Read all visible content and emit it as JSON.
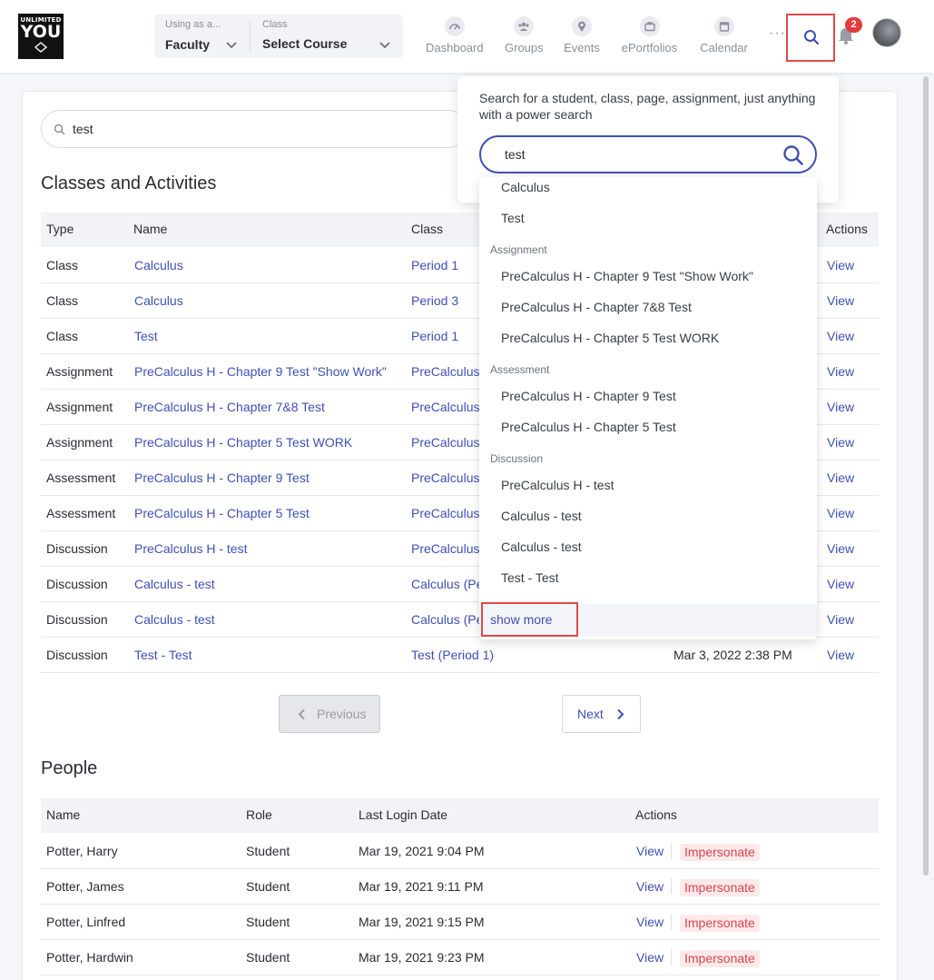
{
  "header": {
    "logo_text_top": "UNLIMITED",
    "logo_text_main": "YOU",
    "using_as_label": "Using as a...",
    "using_as_value": "Faculty",
    "class_label": "Class",
    "class_value": "Select Course",
    "nav": [
      {
        "label": "Dashboard",
        "icon": "gauge-icon"
      },
      {
        "label": "Groups",
        "icon": "groups-icon"
      },
      {
        "label": "Events",
        "icon": "map-pin-icon"
      },
      {
        "label": "ePortfolios",
        "icon": "briefcase-icon"
      },
      {
        "label": "Calendar",
        "icon": "calendar-icon"
      }
    ],
    "more": "···",
    "notification_count": "2"
  },
  "main_search": {
    "value": "test"
  },
  "classes": {
    "title": "Classes and Activities",
    "columns": [
      "Type",
      "Name",
      "Class",
      "Actions"
    ],
    "rows": [
      {
        "type": "Class",
        "name": "Calculus",
        "class": "Period 1",
        "date": "",
        "action": "View"
      },
      {
        "type": "Class",
        "name": "Calculus",
        "class": "Period 3",
        "date": "",
        "action": "View"
      },
      {
        "type": "Class",
        "name": "Test",
        "class": "Period 1",
        "date": "",
        "action": "View"
      },
      {
        "type": "Assignment",
        "name": "PreCalculus H - Chapter 9 Test \"Show Work\"",
        "class": "PreCalculus",
        "date": "",
        "action": "View"
      },
      {
        "type": "Assignment",
        "name": "PreCalculus H - Chapter 7&8 Test",
        "class": "PreCalculus",
        "date": "",
        "action": "View"
      },
      {
        "type": "Assignment",
        "name": "PreCalculus H - Chapter 5 Test WORK",
        "class": "PreCalculus",
        "date": "",
        "action": "View"
      },
      {
        "type": "Assessment",
        "name": "PreCalculus H - Chapter 9 Test",
        "class": "PreCalculus",
        "date": "",
        "action": "View"
      },
      {
        "type": "Assessment",
        "name": "PreCalculus H - Chapter 5 Test",
        "class": "PreCalculus",
        "date": "",
        "action": "View"
      },
      {
        "type": "Discussion",
        "name": "PreCalculus H - test",
        "class": "PreCalculus",
        "date": "",
        "action": "View"
      },
      {
        "type": "Discussion",
        "name": "Calculus - test",
        "class": "Calculus (Pe",
        "date": "",
        "action": "View"
      },
      {
        "type": "Discussion",
        "name": "Calculus - test",
        "class": "Calculus (Pe",
        "date": "",
        "action": "View"
      },
      {
        "type": "Discussion",
        "name": "Test - Test",
        "class": "Test (Period 1)",
        "date": "Mar 3, 2022 2:38 PM",
        "action": "View"
      }
    ]
  },
  "pagination": {
    "previous": "Previous",
    "next": "Next"
  },
  "people": {
    "title": "People",
    "columns": [
      "Name",
      "Role",
      "Last Login Date",
      "Actions"
    ],
    "rows": [
      {
        "name": "Potter, Harry",
        "role": "Student",
        "last_login": "Mar 19, 2021 9:04 PM",
        "view": "View",
        "impersonate": "Impersonate"
      },
      {
        "name": "Potter, James",
        "role": "Student",
        "last_login": "Mar 19, 2021 9:11 PM",
        "view": "View",
        "impersonate": "Impersonate"
      },
      {
        "name": "Potter, Linfred",
        "role": "Student",
        "last_login": "Mar 19, 2021 9:15 PM",
        "view": "View",
        "impersonate": "Impersonate"
      },
      {
        "name": "Potter, Hardwin",
        "role": "Student",
        "last_login": "Mar 19, 2021 9:23 PM",
        "view": "View",
        "impersonate": "Impersonate"
      }
    ]
  },
  "power_search": {
    "hint": "Search for a student, class, page, assignment, just anything with a power search",
    "value": "test",
    "results": [
      {
        "kind": "item",
        "label": "Calculus"
      },
      {
        "kind": "item",
        "label": "Test"
      },
      {
        "kind": "group",
        "label": "Assignment"
      },
      {
        "kind": "item",
        "label": "PreCalculus H - Chapter 9 Test \"Show Work\""
      },
      {
        "kind": "item",
        "label": "PreCalculus H - Chapter 7&8 Test"
      },
      {
        "kind": "item",
        "label": "PreCalculus H - Chapter 5 Test WORK"
      },
      {
        "kind": "group",
        "label": "Assessment"
      },
      {
        "kind": "item",
        "label": "PreCalculus H - Chapter 9 Test"
      },
      {
        "kind": "item",
        "label": "PreCalculus H - Chapter 5 Test"
      },
      {
        "kind": "group",
        "label": "Discussion"
      },
      {
        "kind": "item",
        "label": "PreCalculus H - test"
      },
      {
        "kind": "item",
        "label": "Calculus - test"
      },
      {
        "kind": "item",
        "label": "Calculus - test"
      },
      {
        "kind": "item",
        "label": "Test - Test"
      }
    ],
    "show_more": "show more"
  },
  "colors": {
    "accent": "#3f4fb5",
    "highlight": "#e04a4a",
    "badge": "#e53b3b"
  }
}
